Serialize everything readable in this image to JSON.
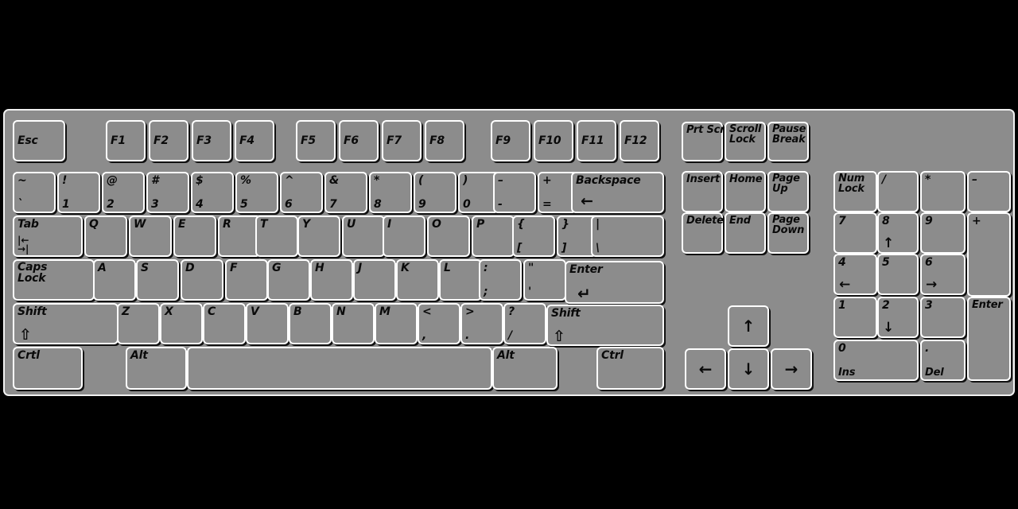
{
  "device": {
    "name": "full-size-104-key-keyboard-diagram",
    "body_color": "#8c8c8c",
    "key_face_color": "#8c8c8c",
    "key_border_color": "#ffffff",
    "legend_color": "#0a0a0a",
    "background_color": "#000000"
  },
  "function_row": {
    "esc": "Esc",
    "f_keys_group1": [
      "F1",
      "F2",
      "F3",
      "F4"
    ],
    "f_keys_group2": [
      "F5",
      "F6",
      "F7",
      "F8"
    ],
    "f_keys_group3": [
      "F9",
      "F10",
      "F11",
      "F12"
    ]
  },
  "number_row": {
    "keys": [
      {
        "shift": "~",
        "base": "`"
      },
      {
        "shift": "!",
        "base": "1"
      },
      {
        "shift": "@",
        "base": "2"
      },
      {
        "shift": "#",
        "base": "3"
      },
      {
        "shift": "$",
        "base": "4"
      },
      {
        "shift": "%",
        "base": "5"
      },
      {
        "shift": "^",
        "base": "6"
      },
      {
        "shift": "&",
        "base": "7"
      },
      {
        "shift": "*",
        "base": "8"
      },
      {
        "shift": "(",
        "base": "9"
      },
      {
        "shift": ")",
        "base": "0"
      },
      {
        "shift": "–",
        "base": "-"
      },
      {
        "shift": "+",
        "base": "="
      }
    ],
    "backspace": {
      "label": "Backspace",
      "glyph": "←"
    }
  },
  "tab_row": {
    "tab": {
      "label": "Tab",
      "glyph_top": "|←",
      "glyph_bottom": "→|"
    },
    "letters": [
      "Q",
      "W",
      "E",
      "R",
      "T",
      "Y",
      "U",
      "I",
      "O",
      "P"
    ],
    "brackets": [
      {
        "shift": "{",
        "base": "["
      },
      {
        "shift": "}",
        "base": "]"
      },
      {
        "shift": "|",
        "base": "\\"
      }
    ]
  },
  "home_row": {
    "caps_lock": {
      "line1": "Caps",
      "line2": "Lock"
    },
    "letters": [
      "A",
      "S",
      "D",
      "F",
      "G",
      "H",
      "J",
      "K",
      "L"
    ],
    "punctuation": [
      {
        "shift": ":",
        "base": ";"
      },
      {
        "shift": "\"",
        "base": "'"
      }
    ],
    "enter": {
      "label": "Enter",
      "glyph": "↵"
    }
  },
  "shift_row": {
    "left_shift": {
      "label": "Shift",
      "glyph": "⇧"
    },
    "letters": [
      "Z",
      "X",
      "C",
      "V",
      "B",
      "N",
      "M"
    ],
    "punctuation": [
      {
        "shift": "<",
        "base": ","
      },
      {
        "shift": ">",
        "base": "."
      },
      {
        "shift": "?",
        "base": "/"
      }
    ],
    "right_shift": {
      "label": "Shift",
      "glyph": "⇧"
    }
  },
  "bottom_row": {
    "left_ctrl": "Crtl",
    "left_alt": "Alt",
    "space": "",
    "right_alt": "Alt",
    "right_ctrl": "Ctrl"
  },
  "nav_cluster": {
    "row1": [
      {
        "label": "Prt Scr"
      },
      {
        "line1": "Scroll",
        "line2": "Lock"
      },
      {
        "line1": "Pause",
        "line2": "Break"
      }
    ],
    "row2": [
      {
        "label": "Insert"
      },
      {
        "label": "Home"
      },
      {
        "line1": "Page",
        "line2": "Up"
      }
    ],
    "row3": [
      {
        "label": "Delete"
      },
      {
        "label": "End"
      },
      {
        "line1": "Page",
        "line2": "Down"
      }
    ]
  },
  "arrow_cluster": {
    "up": "↑",
    "left": "←",
    "down": "↓",
    "right": "→"
  },
  "numpad": {
    "row1": [
      {
        "line1": "Num",
        "line2": "Lock"
      },
      {
        "label": "/"
      },
      {
        "label": "*"
      },
      {
        "label": "–"
      }
    ],
    "row2": [
      {
        "label": "7"
      },
      {
        "label": "8",
        "glyph": "↑"
      },
      {
        "label": "9"
      },
      {
        "label": "+"
      }
    ],
    "row3": [
      {
        "label": "4",
        "glyph": "←"
      },
      {
        "label": "5"
      },
      {
        "label": "6",
        "glyph": "→"
      }
    ],
    "row4": [
      {
        "label": "1"
      },
      {
        "label": "2",
        "glyph": "↓"
      },
      {
        "label": "3"
      },
      {
        "label": "Enter"
      }
    ],
    "row5": [
      {
        "label": "0",
        "sub": "Ins"
      },
      {
        "label": ".",
        "sub": "Del"
      }
    ]
  }
}
